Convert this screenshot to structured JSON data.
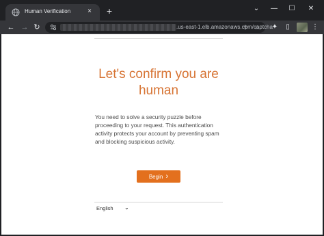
{
  "browser": {
    "tab": {
      "title": "Human Verification",
      "favicon": "globe-icon",
      "close_icon": "×"
    },
    "new_tab_icon": "+",
    "window_controls": {
      "chevron": "⌄",
      "minimize": "—",
      "maximize": "☐",
      "close": "✕"
    },
    "toolbar": {
      "back_icon": "←",
      "forward_icon": "→",
      "reload_icon": "↻",
      "url_visible": ".us-east-1.elb.amazonaws.com/captcha",
      "share_icon": "⇪",
      "star_icon": "☆",
      "extensions_icon": "✦",
      "sidepanel_icon": "▯",
      "menu_icon": "⋮"
    }
  },
  "page": {
    "heading": "Let's confirm you are human",
    "body": "You need to solve a security puzzle before proceeding to your request. This authentication activity protects your account by preventing spam and blocking suspicious activity.",
    "begin_button": "Begin",
    "begin_chevron": "›",
    "language": {
      "selected": "English",
      "chevron": "⌄"
    }
  },
  "colors": {
    "accent": "#e3701e",
    "heading": "#d77434",
    "chrome_dark": "#202124",
    "chrome_toolbar": "#35363a"
  }
}
